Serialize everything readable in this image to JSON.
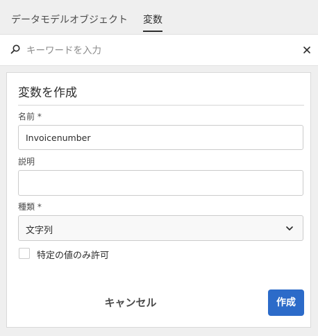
{
  "tabs": [
    {
      "label": "データモデルオブジェクト",
      "active": false
    },
    {
      "label": "変数",
      "active": true
    }
  ],
  "search": {
    "placeholder": "キーワードを入力"
  },
  "icons": {
    "search": "search-icon",
    "clear": "close-icon",
    "dropdown": "chevron-down-icon"
  },
  "dialog": {
    "title": "変数を作成",
    "name": {
      "label": "名前 *",
      "value": "Invoicenumber"
    },
    "description": {
      "label": "説明",
      "value": ""
    },
    "type": {
      "label": "種類 *",
      "selected": "文字列"
    },
    "restrict": {
      "label": "特定の値のみ許可",
      "checked": false
    },
    "cancel_label": "キャンセル",
    "create_label": "作成"
  },
  "colors": {
    "accent": "#2c6bc9",
    "background": "#efefef"
  }
}
